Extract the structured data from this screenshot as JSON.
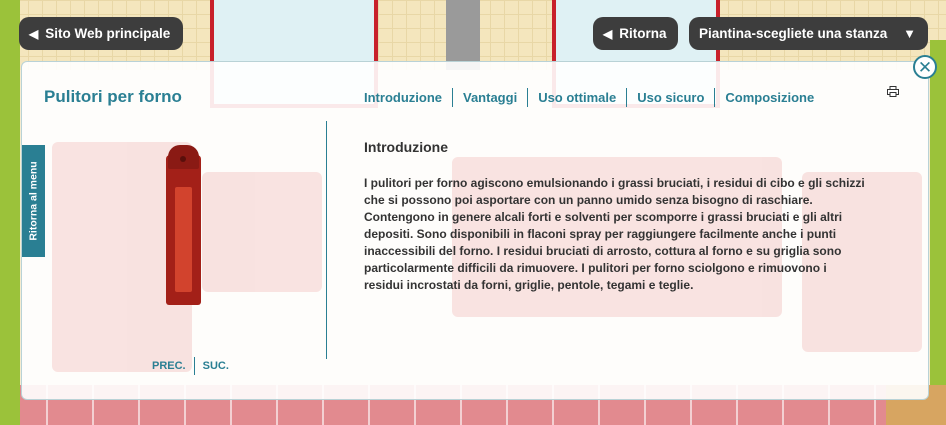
{
  "nav": {
    "site_label": "Sito Web principale",
    "back_label": "Ritorna",
    "plan_label": "Piantina-scegliete una stanza"
  },
  "panel": {
    "title": "Pulitori per forno",
    "tabs": [
      "Introduzione",
      "Vantaggi",
      "Uso ottimale",
      "Uso sicuro",
      "Composizione"
    ],
    "side_tab": "Ritorna al menu",
    "prev": "PREC.",
    "next": "SUC.",
    "section_title": "Introduzione",
    "body": "I pulitori per forno agiscono emulsionando i grassi bruciati, i residui di cibo e gli schizzi che si possono poi asportare con un panno umido senza bisogno di raschiare. Contengono in genere alcali forti e solventi per scomporre i grassi bruciati e gli altri depositi. Sono disponibili in flaconi spray per raggiungere facilmente anche i punti inaccessibili del forno.  I residui bruciati di arrosto, cottura al forno e su griglia sono particolarmente difficili da rimuovere. I pulitori per forno sciolgono e rimuovono i residui incrostati da forni, griglie, pentole, tegami e teglie."
  },
  "icons": {
    "close": "close-icon",
    "print": "print-icon",
    "back_arrow": "arrow-left-icon",
    "dropdown": "arrow-down-icon"
  },
  "colors": {
    "accent": "#2a7f93",
    "button_dark": "#3d3d3d",
    "product_red": "#a32018"
  }
}
